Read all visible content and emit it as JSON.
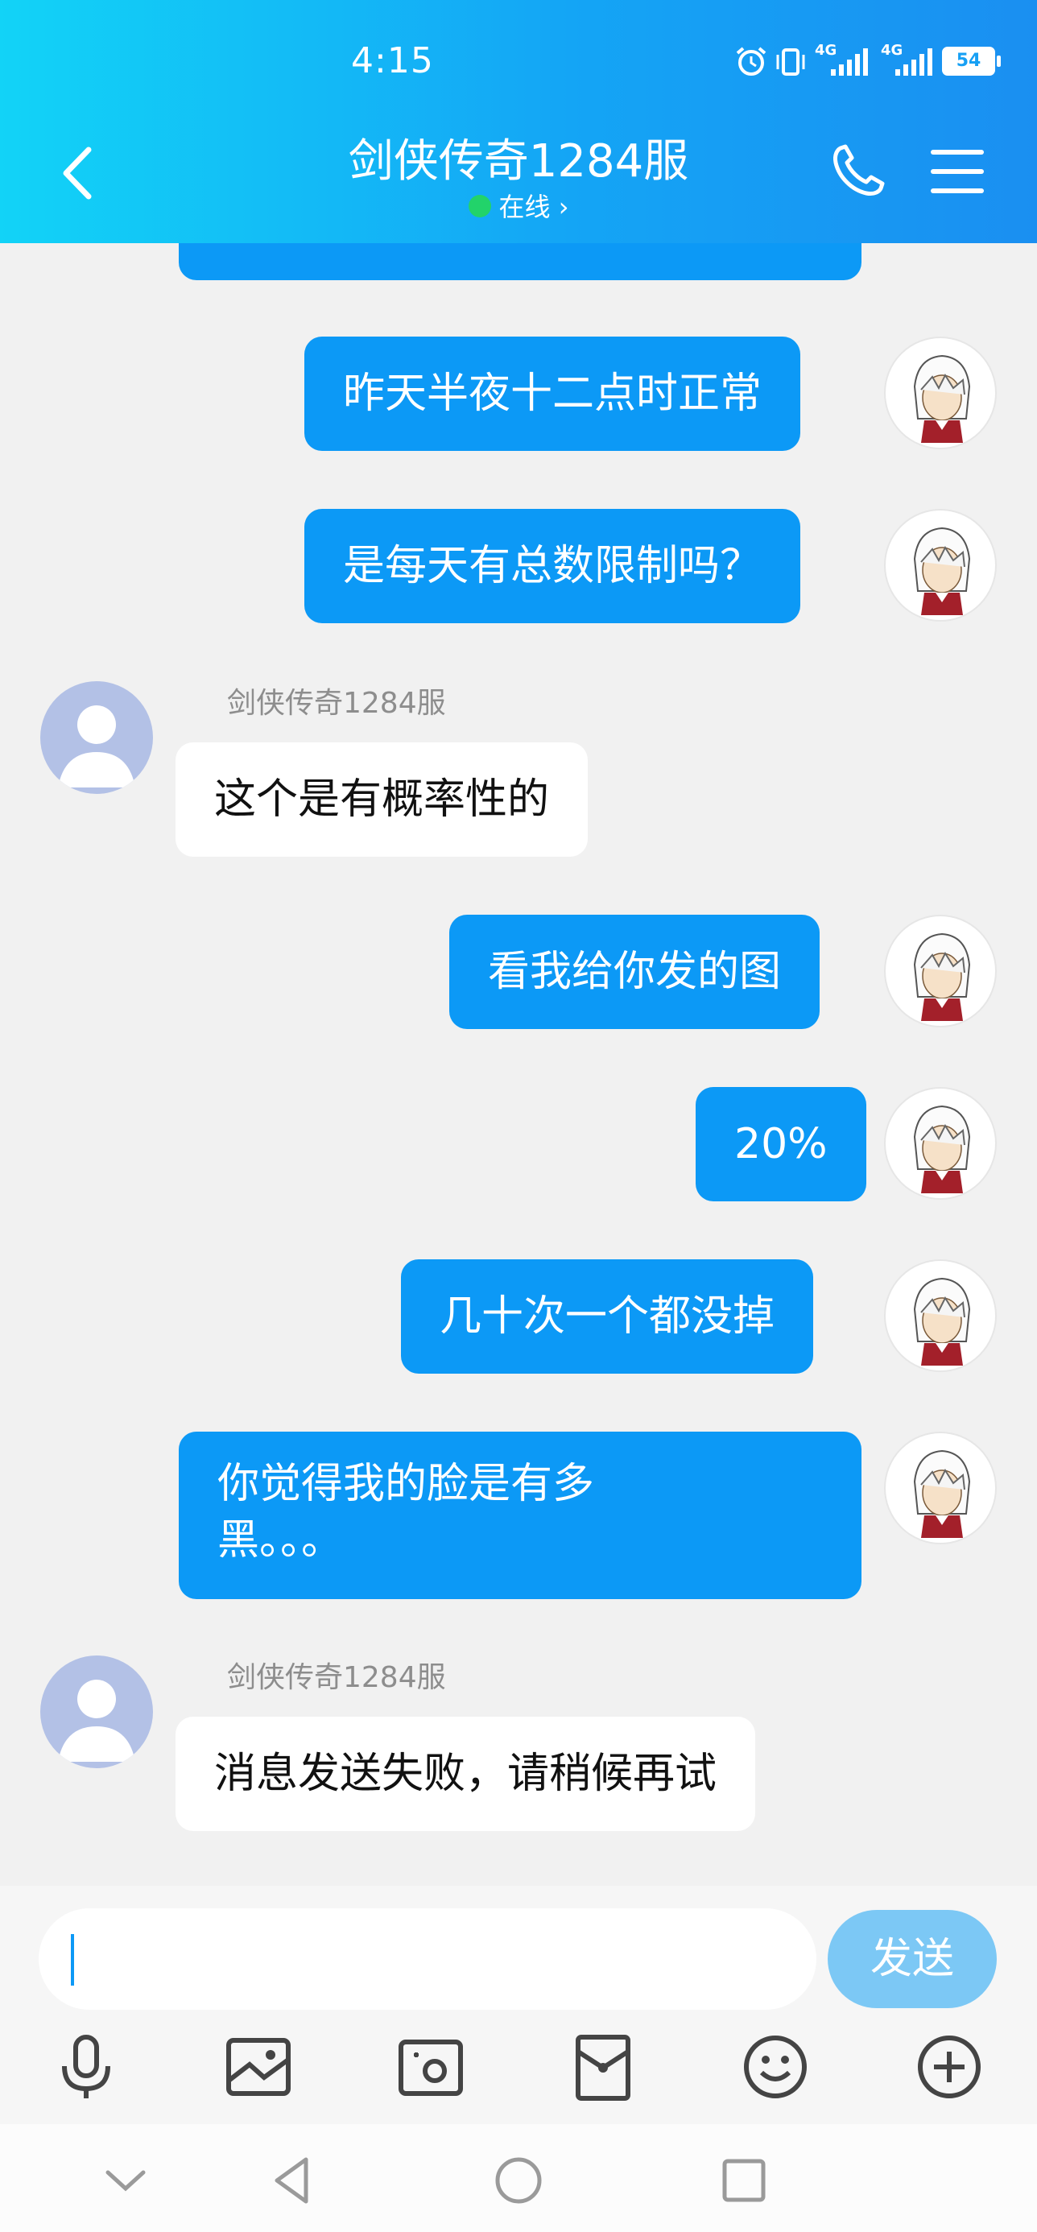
{
  "status_bar": {
    "time": "4:15",
    "network_1": "4G",
    "network_2": "4G",
    "battery": "54"
  },
  "header": {
    "title": "剑侠传奇1284服",
    "status": "在线",
    "status_chevron": "›"
  },
  "messages": [
    {
      "from": "me",
      "text": "昨天半夜十二点时正常"
    },
    {
      "from": "me",
      "text": "是每天有总数限制吗？"
    },
    {
      "from": "them",
      "sender": "剑侠传奇1284服",
      "text": "这个是有概率性的"
    },
    {
      "from": "me",
      "text": "看我给你发的图"
    },
    {
      "from": "me",
      "text": "20%"
    },
    {
      "from": "me",
      "text": "几十次一个都没掉"
    },
    {
      "from": "me",
      "line1": "你觉得我的脸是有多",
      "line2": "黑。。。"
    },
    {
      "from": "them",
      "sender": "剑侠传奇1284服",
      "text": "消息发送失败，请稍候再试"
    }
  ],
  "input": {
    "value": "",
    "send_label": "发送"
  },
  "toolbar": [
    "microphone-icon",
    "image-icon",
    "camera-icon",
    "red-packet-icon",
    "emoji-icon",
    "plus-icon"
  ],
  "colors": {
    "accent": "#0c99f6",
    "header_start": "#12d3f7",
    "header_end": "#1a8ff1",
    "send_disabled": "#7cc8f5"
  }
}
